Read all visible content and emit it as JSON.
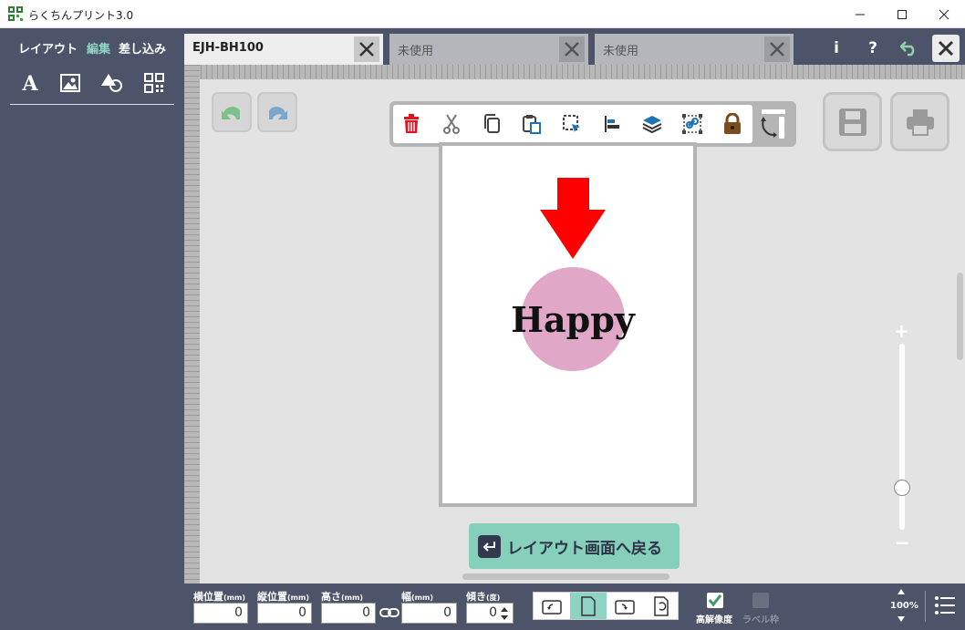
{
  "window": {
    "title": "らくちんプリント3.0"
  },
  "sidebar": {
    "tabs": [
      {
        "label": "レイアウト"
      },
      {
        "label": "編集"
      },
      {
        "label": "差し込み"
      }
    ],
    "active_tab": "編集",
    "tools": [
      "text-icon",
      "image-icon",
      "shape-icon",
      "qr-code-icon"
    ]
  },
  "tabs": [
    {
      "label": "EJH-BH100"
    },
    {
      "label": "未使用"
    },
    {
      "label": "未使用"
    }
  ],
  "header": {
    "info": "i",
    "help": "?"
  },
  "toolbar": {
    "icons": [
      "trash-icon",
      "cut-icon",
      "copy-icon",
      "paste-icon",
      "select-icon",
      "align-icon",
      "layers-icon",
      "group-icon",
      "lock-icon",
      "rotate-icon"
    ],
    "delete_color": "#e8101a",
    "lock_color": "#7a4e1c"
  },
  "canvas": {
    "text": "Happy",
    "arrow_color": "#ff0000",
    "circle_color": "#e1a7c6"
  },
  "back_button": {
    "label": "レイアウト画面へ戻る"
  },
  "zoom": {
    "plus": "+",
    "minus": "−",
    "level": "100%"
  },
  "bottom": {
    "fields": [
      {
        "label": "横位置",
        "unit": "(mm)",
        "value": "0"
      },
      {
        "label": "縦位置",
        "unit": "(mm)",
        "value": "0"
      },
      {
        "label": "高さ",
        "unit": "(mm)",
        "value": "0"
      },
      {
        "label": "幅",
        "unit": "(mm)",
        "value": "0"
      },
      {
        "label": "傾き",
        "unit": "(度)",
        "value": "0"
      }
    ],
    "high_res": {
      "label": "高解像度",
      "checked": true
    },
    "label_frame": {
      "label": "ラベル枠",
      "checked": false
    }
  },
  "colors": {
    "accent": "#8fd3c5",
    "sidebar": "#4d5368"
  }
}
